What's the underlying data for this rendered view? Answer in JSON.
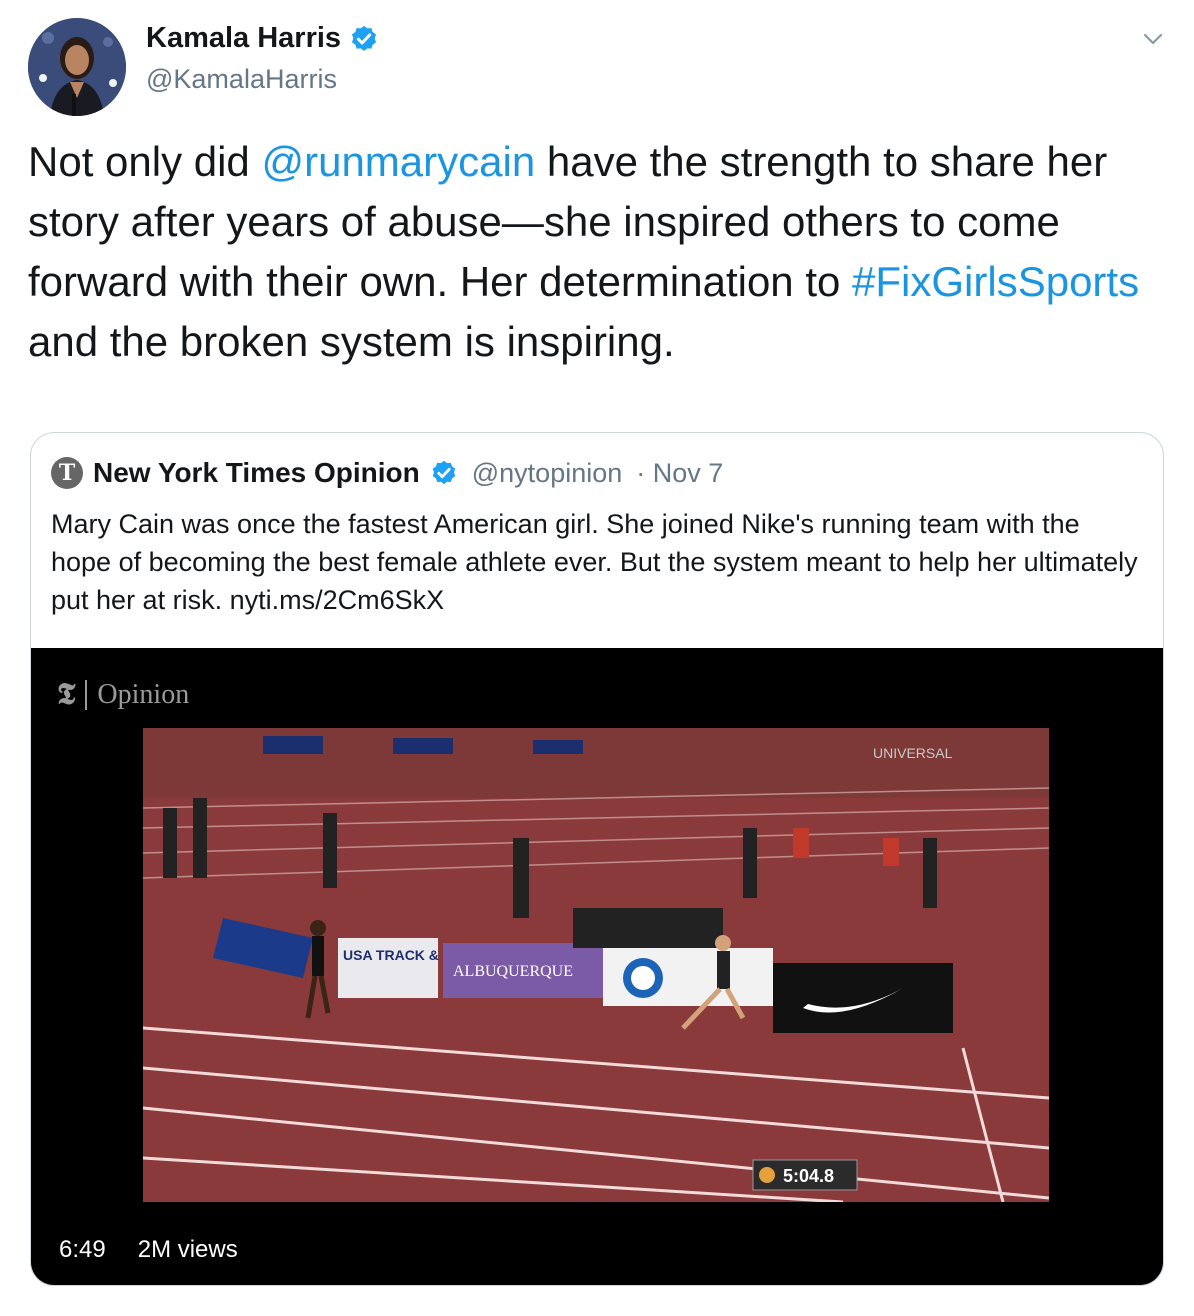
{
  "author": {
    "name": "Kamala Harris",
    "handle": "@KamalaHarris",
    "verified": true,
    "avatar_icon": "profile-photo"
  },
  "tweet": {
    "parts": [
      {
        "text": "Not only did ",
        "type": "text"
      },
      {
        "text": "@runmarycain",
        "type": "mention"
      },
      {
        "text": " have the strength to share her story after years of abuse—she inspired others to come forward with their own. Her determination to ",
        "type": "text"
      },
      {
        "text": "#FixGirlsSports",
        "type": "hashtag"
      },
      {
        "text": " and the broken system is inspiring.",
        "type": "text"
      }
    ]
  },
  "quoted": {
    "name": "New York Times Opinion",
    "handle": "@nytopinion",
    "date": "· Nov 7",
    "verified": true,
    "text": "Mary Cain was once the fastest American girl. She joined Nike's running team with the hope of becoming the best female athlete ever. But the system meant to help her ultimately put her at risk. nyti.ms/2Cm6SkX",
    "video": {
      "watermark": "Opinion",
      "duration": "6:49",
      "views": "2M views",
      "scene_timer": "5:04.8",
      "banners": [
        "USA TRACK & FIELD SERIES",
        "ALBUQUERQUE",
        "UNIVERSAL"
      ]
    }
  },
  "colors": {
    "link": "#1b95e0",
    "verified": "#1da1f2",
    "track": "#8f3b3b"
  }
}
